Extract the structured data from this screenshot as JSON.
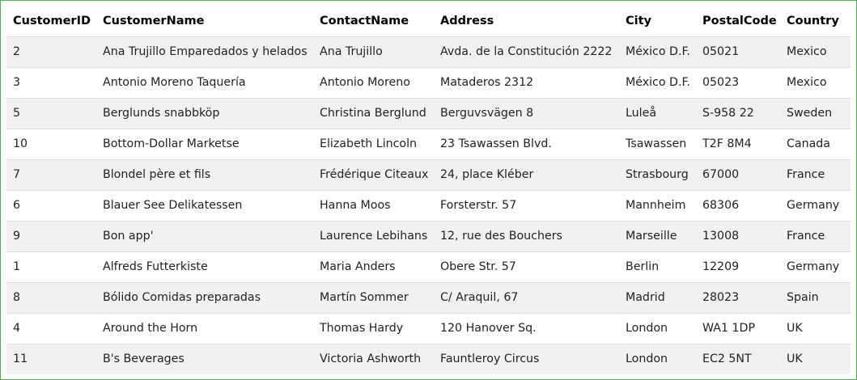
{
  "table": {
    "columns": [
      "CustomerID",
      "CustomerName",
      "ContactName",
      "Address",
      "City",
      "PostalCode",
      "Country"
    ],
    "rows": [
      [
        "2",
        "Ana Trujillo Emparedados y helados",
        "Ana Trujillo",
        "Avda. de la Constitución 2222",
        "México D.F.",
        "05021",
        "Mexico"
      ],
      [
        "3",
        "Antonio Moreno Taquería",
        "Antonio Moreno",
        "Mataderos 2312",
        "México D.F.",
        "05023",
        "Mexico"
      ],
      [
        "5",
        "Berglunds snabbköp",
        "Christina Berglund",
        "Berguvsvägen 8",
        "Luleå",
        "S-958 22",
        "Sweden"
      ],
      [
        "10",
        "Bottom-Dollar Marketse",
        "Elizabeth Lincoln",
        "23 Tsawassen Blvd.",
        "Tsawassen",
        "T2F 8M4",
        "Canada"
      ],
      [
        "7",
        "Blondel père et fils",
        "Frédérique Citeaux",
        "24, place Kléber",
        "Strasbourg",
        "67000",
        "France"
      ],
      [
        "6",
        "Blauer See Delikatessen",
        "Hanna Moos",
        "Forsterstr. 57",
        "Mannheim",
        "68306",
        "Germany"
      ],
      [
        "9",
        "Bon app'",
        "Laurence Lebihans",
        "12, rue des Bouchers",
        "Marseille",
        "13008",
        "France"
      ],
      [
        "1",
        "Alfreds Futterkiste",
        "Maria Anders",
        "Obere Str. 57",
        "Berlin",
        "12209",
        "Germany"
      ],
      [
        "8",
        "Bólido Comidas preparadas",
        "Martín Sommer",
        "C/ Araquil, 67",
        "Madrid",
        "28023",
        "Spain"
      ],
      [
        "4",
        "Around the Horn",
        "Thomas Hardy",
        "120 Hanover Sq.",
        "London",
        "WA1 1DP",
        "UK"
      ],
      [
        "11",
        "B's Beverages",
        "Victoria Ashworth",
        "Fauntleroy Circus",
        "London",
        "EC2 5NT",
        "UK"
      ]
    ]
  },
  "colors": {
    "border": "#4CAF50",
    "stripe": "#f1f1f1",
    "row_divider": "#dddddd"
  }
}
